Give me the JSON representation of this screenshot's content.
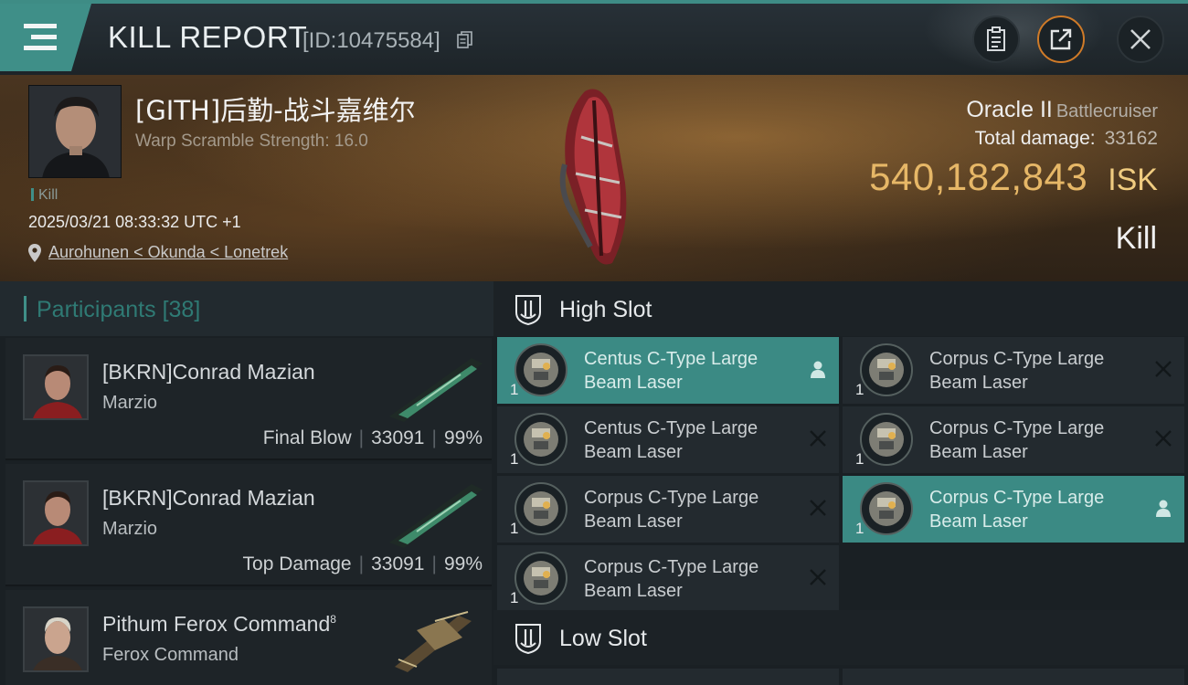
{
  "header": {
    "title": "KILL REPORT",
    "id_label": "[ID:10475584]"
  },
  "victim": {
    "name": "[GITH]后勤-战斗嘉维尔",
    "warp_scramble": "Warp Scramble Strength: 16.0",
    "tag": "Kill",
    "datetime": "2025/03/21 08:33:32 UTC +1",
    "location": "Aurohunen < Okunda < Lonetrek",
    "ship_name": "Oracle II",
    "ship_class": "Battlecruiser",
    "total_damage_label": "Total damage:",
    "total_damage": "33162",
    "isk_value": "540,182,843",
    "isk_unit": "ISK",
    "status": "Kill"
  },
  "participants": {
    "title": "Participants",
    "count": "[38]",
    "rows": [
      {
        "name": "[BKRN]Conrad Mazian",
        "ship": "Marzio",
        "role": "Final Blow",
        "damage": "33091",
        "percent": "99%"
      },
      {
        "name": "[BKRN]Conrad Mazian",
        "ship": "Marzio",
        "role": "Top Damage",
        "damage": "33091",
        "percent": "99%"
      },
      {
        "name": "Pithum Ferox Command",
        "name_sup": "8",
        "ship": "Ferox Command"
      }
    ]
  },
  "fitting": {
    "high_slot_title": "High Slot",
    "low_slot_title": "Low Slot",
    "high_modules": [
      {
        "line1": "Centus C-Type Large",
        "line2": "Beam Laser",
        "qty": "1",
        "highlighted": true,
        "action_icon": "pilot-icon"
      },
      {
        "line1": "Corpus C-Type Large",
        "line2": "Beam Laser",
        "qty": "1",
        "highlighted": false,
        "action_icon": "close-icon"
      },
      {
        "line1": "Centus C-Type Large",
        "line2": "Beam Laser",
        "qty": "1",
        "highlighted": false,
        "action_icon": "close-icon"
      },
      {
        "line1": "Corpus C-Type Large",
        "line2": "Beam Laser",
        "qty": "1",
        "highlighted": false,
        "action_icon": "close-icon"
      },
      {
        "line1": "Corpus C-Type Large",
        "line2": "Beam Laser",
        "qty": "1",
        "highlighted": false,
        "action_icon": "close-icon"
      },
      {
        "line1": "Corpus C-Type Large",
        "line2": "Beam Laser",
        "qty": "1",
        "highlighted": true,
        "action_icon": "pilot-icon"
      },
      {
        "line1": "Corpus C-Type Large",
        "line2": "Beam Laser",
        "qty": "1",
        "highlighted": false,
        "action_icon": "close-icon"
      }
    ]
  },
  "colors": {
    "accent_teal": "#3f8f88",
    "isk_gold": "#e6b767",
    "hero_brown": "#4a3520"
  }
}
